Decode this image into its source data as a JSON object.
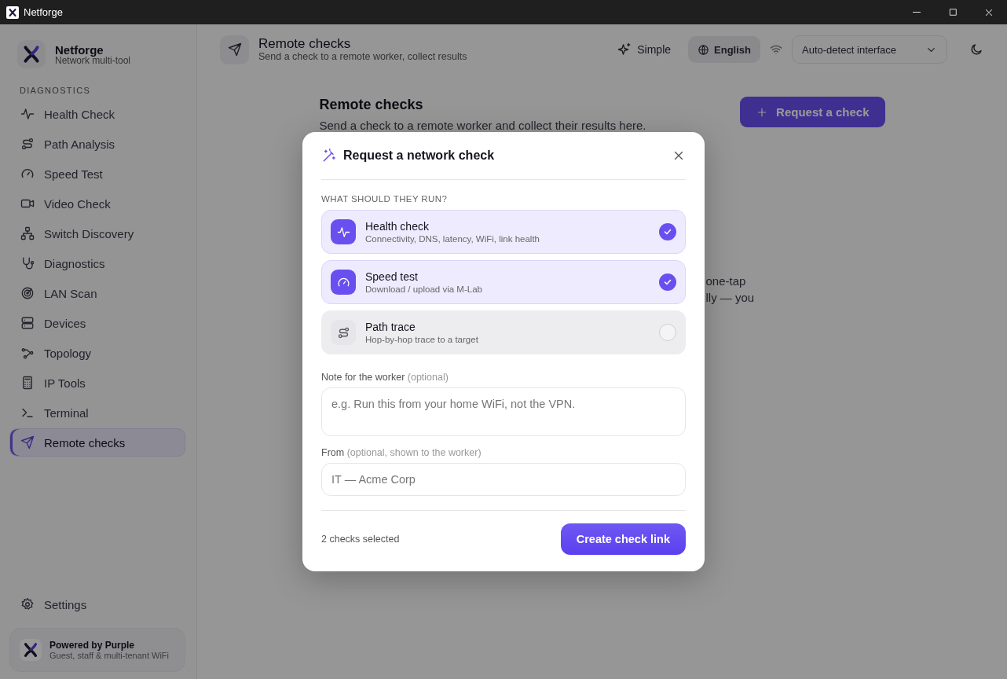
{
  "window": {
    "title": "Netforge"
  },
  "brand": {
    "name": "Netforge",
    "tagline": "Network multi-tool"
  },
  "sidebar": {
    "section": "DIAGNOSTICS",
    "items": [
      {
        "label": "Health Check",
        "selected": false
      },
      {
        "label": "Path Analysis",
        "selected": false
      },
      {
        "label": "Speed Test",
        "selected": false
      },
      {
        "label": "Video Check",
        "selected": false
      },
      {
        "label": "Switch Discovery",
        "selected": false
      },
      {
        "label": "Diagnostics",
        "selected": false
      },
      {
        "label": "LAN Scan",
        "selected": false
      },
      {
        "label": "Devices",
        "selected": false
      },
      {
        "label": "Topology",
        "selected": false
      },
      {
        "label": "IP Tools",
        "selected": false
      },
      {
        "label": "Terminal",
        "selected": false
      },
      {
        "label": "Remote checks",
        "selected": true
      }
    ],
    "settings": "Settings",
    "footer": {
      "title": "Powered by Purple",
      "subtitle": "Guest, staff & multi-tenant WiFi"
    }
  },
  "header": {
    "title": "Remote checks",
    "subtitle": "Send a check to a remote worker, collect results",
    "mode": "Simple",
    "language": "English",
    "interface": "Auto-detect interface"
  },
  "page": {
    "title": "Remote checks",
    "subtitle": "Send a check to a remote worker and collect their results here.",
    "request_button": "Request a check",
    "partial_lines": [
      "one-tap",
      "lly — you"
    ]
  },
  "modal": {
    "title": "Request a network check",
    "section": "WHAT SHOULD THEY RUN?",
    "options": [
      {
        "title": "Health check",
        "description": "Connectivity, DNS, latency, WiFi, link health",
        "selected": true
      },
      {
        "title": "Speed test",
        "description": "Download / upload via M-Lab",
        "selected": true
      },
      {
        "title": "Path trace",
        "description": "Hop-by-hop trace to a target",
        "selected": false
      }
    ],
    "note": {
      "label": "Note for the worker",
      "hint": "(optional)",
      "placeholder": "e.g. Run this from your home WiFi, not the VPN."
    },
    "from": {
      "label": "From",
      "hint": "(optional, shown to the worker)",
      "placeholder": "IT — Acme Corp"
    },
    "summary": "2 checks selected",
    "submit": "Create check link"
  }
}
